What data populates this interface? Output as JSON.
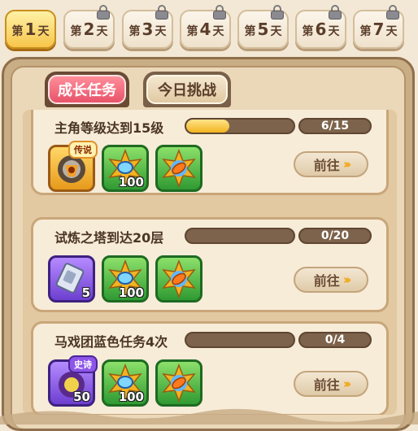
{
  "days": [
    {
      "day": "1",
      "prefix": "第",
      "suffix": "天",
      "active": true,
      "locked": false
    },
    {
      "day": "2",
      "prefix": "第",
      "suffix": "天",
      "active": false,
      "locked": true
    },
    {
      "day": "3",
      "prefix": "第",
      "suffix": "天",
      "active": false,
      "locked": true
    },
    {
      "day": "4",
      "prefix": "第",
      "suffix": "天",
      "active": false,
      "locked": true
    },
    {
      "day": "5",
      "prefix": "第",
      "suffix": "天",
      "active": false,
      "locked": true
    },
    {
      "day": "6",
      "prefix": "第",
      "suffix": "天",
      "active": false,
      "locked": true
    },
    {
      "day": "7",
      "prefix": "第",
      "suffix": "天",
      "active": false,
      "locked": true
    }
  ],
  "task_tabs": {
    "growth": "成长任务",
    "today": "今日挑战",
    "selected": "growth"
  },
  "tasks": [
    {
      "title": "主角等级达到15级",
      "progress": "6/15",
      "progress_fraction": 0.4,
      "go_label": "前往",
      "rewards": [
        {
          "icon": "legendary-hero-shard-icon",
          "frame": "gold",
          "badge": "传说",
          "qty": ""
        },
        {
          "icon": "blue-gem-emblem-icon",
          "frame": "green",
          "badge": "",
          "qty": "100"
        },
        {
          "icon": "orange-leaf-emblem-icon",
          "frame": "green",
          "badge": "",
          "qty": ""
        }
      ]
    },
    {
      "title": "试炼之塔到达20层",
      "progress": "0/20",
      "progress_fraction": 0,
      "go_label": "前往",
      "rewards": [
        {
          "icon": "silver-ticket-icon",
          "frame": "purple",
          "badge": "",
          "qty": "5"
        },
        {
          "icon": "blue-gem-emblem-icon",
          "frame": "green",
          "badge": "",
          "qty": "100"
        },
        {
          "icon": "orange-leaf-emblem-icon",
          "frame": "green",
          "badge": "",
          "qty": ""
        }
      ]
    },
    {
      "title": "马戏团蓝色任务4次",
      "progress": "0/4",
      "progress_fraction": 0,
      "go_label": "前往",
      "rewards": [
        {
          "icon": "epic-hero-shard-icon",
          "frame": "purple",
          "badge": "史诗",
          "qty": "50"
        },
        {
          "icon": "blue-gem-emblem-icon",
          "frame": "green",
          "badge": "",
          "qty": "100"
        },
        {
          "icon": "orange-leaf-emblem-icon",
          "frame": "green",
          "badge": "",
          "qty": ""
        }
      ]
    }
  ]
}
